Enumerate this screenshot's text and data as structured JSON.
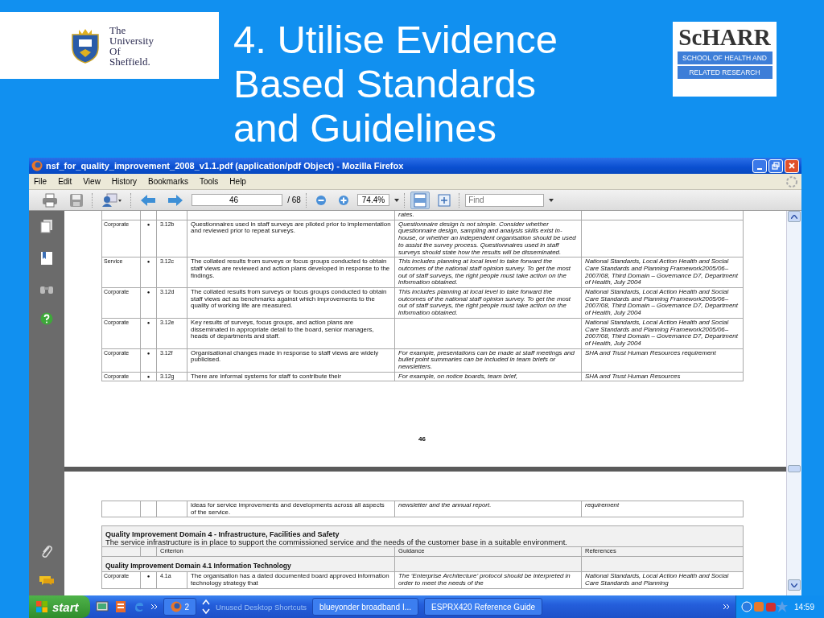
{
  "slide": {
    "title": "4. Utilise Evidence Based Standards and Guidelines",
    "logo_left": {
      "lines": [
        "The",
        "University",
        "Of",
        "Sheffield."
      ]
    },
    "logo_right": {
      "name": "ScHARR",
      "lines": [
        "SCHOOL OF HEALTH AND",
        "RELATED RESEARCH"
      ]
    }
  },
  "window": {
    "title": "nsf_for_quality_improvement_2008_v1.1.pdf (application/pdf Object) - Mozilla Firefox",
    "menu": [
      "File",
      "Edit",
      "View",
      "History",
      "Bookmarks",
      "Tools",
      "Help"
    ],
    "toolbar": {
      "page_field": "46",
      "page_count": "/ 68",
      "zoom_field": "74.4%",
      "find": {
        "placeholder": "Find"
      },
      "fit_page_pressed": true
    }
  },
  "pages": [
    {
      "rows": [
        {
          "kind": "continuation",
          "guidance": "rates."
        },
        {
          "kind": "criterion",
          "type": "Corporate",
          "bullet": "●",
          "code": "3.12b",
          "criterion": "Questionnaires used in staff surveys are piloted prior to implementation and reviewed prior to repeat surveys.",
          "guidance": "Questionnaire design is not simple. Consider whether questionnaire design, sampling and analysis skills exist in-house, or whether an independent organisation should be used to assist the survey process. Questionnaires used in staff surveys should state how the results will be disseminated."
        },
        {
          "kind": "criterion",
          "type": "Service",
          "bullet": "●",
          "code": "3.12c",
          "criterion": "The collated results from surveys or focus groups conducted to obtain staff views are reviewed and action plans developed in response to the findings.",
          "guidance": "This includes planning at local level to take forward the outcomes of the national staff opinion survey. To get the most out of staff surveys, the right people must take action on the information obtained.",
          "references": "National Standards, Local Action Health and Social Care Standards and Planning Framework2005/06–2007/08, Third Domain – Governance D7, Department of Health, July 2004"
        },
        {
          "kind": "criterion",
          "type": "Corporate",
          "bullet": "●",
          "code": "3.12d",
          "criterion": "The collated results from surveys or focus groups conducted to obtain staff views act as benchmarks against which improvements to the quality of working life are measured.",
          "guidance": "This includes planning at local level to take forward the outcomes of the national staff opinion survey. To get the most out of staff surveys, the right people must take action on the information obtained.",
          "references": "National Standards, Local Action Health and Social Care Standards and Planning Framework2005/06–2007/08, Third Domain – Governance D7, Department of Health, July 2004"
        },
        {
          "kind": "criterion",
          "type": "Corporate",
          "bullet": "●",
          "code": "3.12e",
          "criterion": "Key results of surveys, focus groups, and action plans are disseminated in appropriate detail to the board, senior managers, heads of departments and staff.",
          "references": "National Standards, Local Action Health and Social Care Standards and Planning Framework2005/06–2007/08, Third Domain – Governance D7, Department of Health, July 2004"
        },
        {
          "kind": "criterion",
          "type": "Corporate",
          "bullet": "●",
          "code": "3.12f",
          "criterion": "Organisational changes made in response to staff views are widely publicised.",
          "guidance": "For example, presentations can be made at staff meetings and bullet point summaries can be included in team briefs or newsletters.",
          "references": "SHA and Trust Human Resources requirement"
        },
        {
          "kind": "criterion",
          "type": "Corporate",
          "bullet": "●",
          "code": "3.12g",
          "criterion": "There are informal systems for staff to contribute their",
          "guidance": "For example, on notice boards, team brief,",
          "references": "SHA and Trust Human Resources"
        }
      ],
      "page_number": "46"
    },
    {
      "rows": [
        {
          "criterion": "ideas for service improvements and developments across all aspects of the service.",
          "guidance": "newsletter and the annual report.",
          "references": "requirement"
        }
      ],
      "domain": {
        "heading": "Quality Improvement Domain 4 - Infrastructure, Facilities and Safety",
        "description": "The service infrastructure is in place to support the commissioned service and the needs of the customer base in a suitable environment.",
        "columns": [
          "Criterion",
          "Guidance",
          "References"
        ],
        "subheading": "Quality Improvement Domain 4.1  Information Technology",
        "rows": [
          {
            "type": "Corporate",
            "bullet": "●",
            "code": "4.1a",
            "criterion": "The organisation has a dated documented board approved information technology strategy that",
            "guidance": "The ‘Enterprise Architecture’ protocol should be interpreted in order to meet the needs of the",
            "references": "National Standards, Local Action Health and Social Care Standards and Planning"
          }
        ]
      }
    }
  ],
  "taskbar": {
    "start": "start",
    "group_count": "2",
    "toolbar_label": "Unused Desktop Shortcuts",
    "tasks": [
      "blueyonder broadband I...",
      "ESPRX420 Reference Guide"
    ],
    "clock": "14:59"
  }
}
